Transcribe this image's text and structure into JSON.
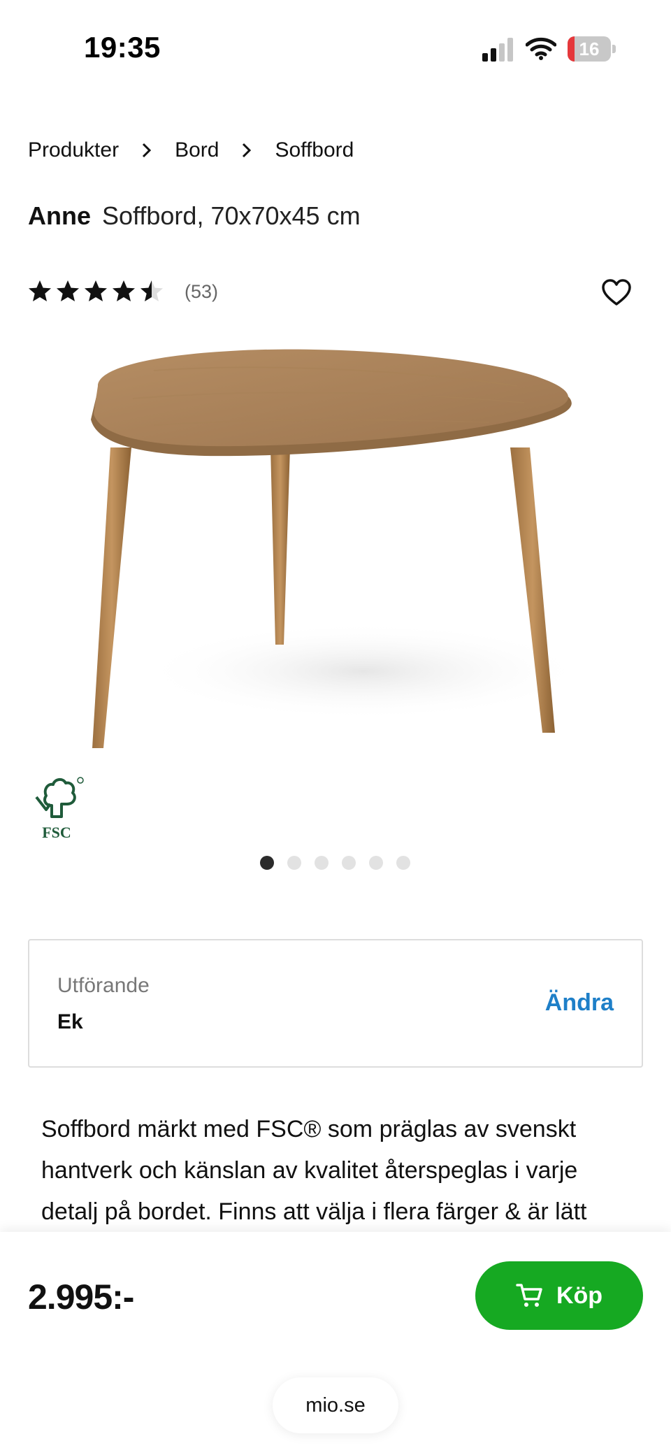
{
  "status_bar": {
    "time": "19:35",
    "battery": "16",
    "battery_level": 0.16
  },
  "breadcrumb": {
    "items": [
      "Produkter",
      "Bord",
      "Soffbord"
    ]
  },
  "product": {
    "name": "Anne",
    "description_short": "Soffbord, 70x70x45 cm",
    "rating": 4.5,
    "rating_max": 5,
    "review_count": "(53)",
    "certification": "FSC"
  },
  "carousel": {
    "count": 6,
    "active_index": 0
  },
  "variant": {
    "label": "Utförande",
    "value": "Ek",
    "change_label": "Ändra"
  },
  "description": "Soffbord märkt med FSC® som präglas av svenskt hantverk och känslan av kvalitet återspeglas i varje detalj på bordet. Finns att välja i flera färger & är lätt",
  "purchase": {
    "price": "2.995:-",
    "buy_label": "Köp"
  },
  "browser": {
    "url": "mio.se"
  },
  "colors": {
    "accent_green": "#16a922",
    "link_blue": "#1e7fc8",
    "fsc_green": "#1f5b3a"
  },
  "icons": [
    "signal-icon",
    "wifi-icon",
    "chevron-right-icon",
    "star-icon",
    "heart-icon",
    "fsc-tree-icon",
    "cart-icon"
  ]
}
